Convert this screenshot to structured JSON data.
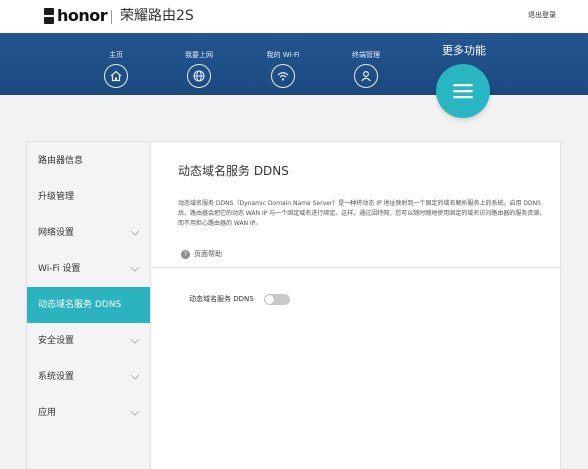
{
  "header": {
    "brand": "honor",
    "product_name": "荣耀路由2S",
    "logout_label": "退出登录"
  },
  "nav": {
    "items": [
      {
        "label": "主页",
        "icon": "home-icon"
      },
      {
        "label": "我要上网",
        "icon": "globe-icon"
      },
      {
        "label": "我的 Wi-Fi",
        "icon": "wifi-icon"
      },
      {
        "label": "终端管理",
        "icon": "user-icon"
      }
    ],
    "active_label": "更多功能",
    "active_icon": "menu-icon",
    "accent_color": "#28b6c2",
    "band_color": "#1f4f88"
  },
  "sidebar": {
    "items": [
      {
        "label": "路由器信息",
        "expandable": false
      },
      {
        "label": "升级管理",
        "expandable": false
      },
      {
        "label": "网络设置",
        "expandable": true
      },
      {
        "label": "Wi-Fi 设置",
        "expandable": true
      },
      {
        "label": "动态域名服务 DDNS",
        "expandable": false,
        "active": true
      },
      {
        "label": "安全设置",
        "expandable": true
      },
      {
        "label": "系统设置",
        "expandable": true
      },
      {
        "label": "应用",
        "expandable": true
      }
    ]
  },
  "main": {
    "title": "动态域名服务 DDNS",
    "description": "动态域名服务 DDNS（Dynamic Domain Name Server）是一种将动态 IP 地址映射到一个固定的域名解析服务上的系统。启用 DDNS 后，路由器会把它的动态 WAN IP 与一个固定域名进行绑定。这样，通过因特网，您可以随时随地使用固定的域名访问路由器的服务资源，而不用担心路由器的 WAN IP。",
    "help_label": "页面帮助",
    "ddns_toggle_label": "动态域名服务 DDNS",
    "ddns_enabled": false
  }
}
